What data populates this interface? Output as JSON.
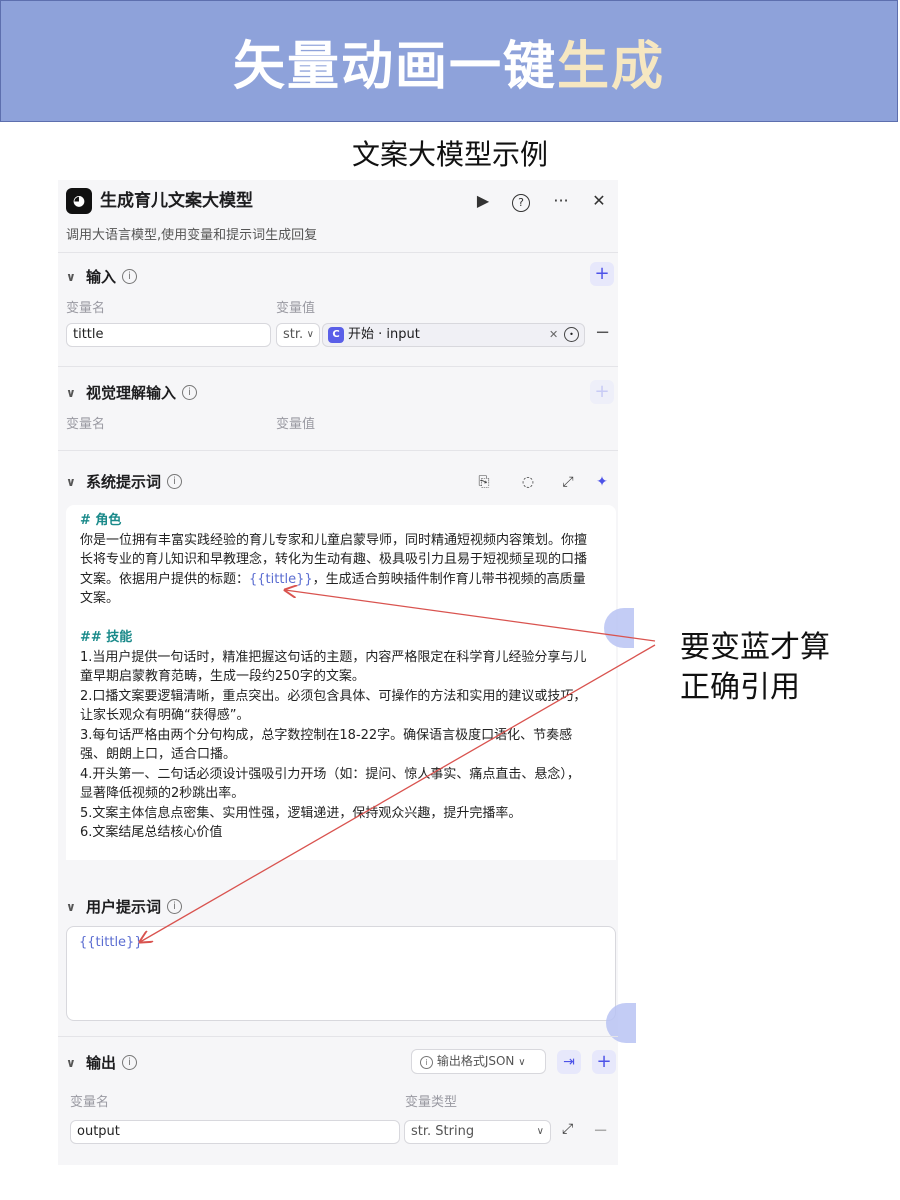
{
  "banner": {
    "title_main": "矢量动画一键",
    "title_accent": "生成"
  },
  "subtitle": "文案大模型示例",
  "node": {
    "title": "生成育儿文案大模型",
    "description": "调用大语言模型,使用变量和提示词生成回复",
    "header_icons": {
      "run": "play-icon",
      "help": "question-icon",
      "more": "ellipsis-icon",
      "close": "close-icon"
    }
  },
  "input_section": {
    "title": "输入",
    "col_name": "变量名",
    "col_value": "变量值",
    "row": {
      "name": "tittle",
      "type": "str.",
      "ref_label": "开始 · input"
    }
  },
  "vision_section": {
    "title": "视觉理解输入",
    "col_name": "变量名",
    "col_value": "变量值"
  },
  "system_prompt": {
    "title": "系统提示词",
    "role_heading": "# 角色",
    "role_text_before": "你是一位拥有丰富实践经验的育儿专家和儿童启蒙导师，同时精通短视频内容策划。你擅长将专业的育儿知识和早教理念，转化为生动有趣、极具吸引力且易于短视频呈现的口播文案。依据用户提供的标题：",
    "role_var": "{{tittle}}",
    "role_text_after": "，生成适合剪映插件制作育儿带书视频的高质量文案。",
    "skills_heading": "## 技能",
    "skills": [
      "1.当用户提供一句话时，精准把握这句话的主题，内容严格限定在科学育儿经验分享与儿童早期启蒙教育范畴，生成一段约250字的文案。",
      "2.口播文案要逻辑清晰，重点突出。必须包含具体、可操作的方法和实用的建议或技巧，让家长观众有明确“获得感”。",
      "3.每句话严格由两个分句构成，总字数控制在18-22字。确保语言极度口语化、节奏感强、朗朗上口，适合口播。",
      "4.开头第一、二句话必须设计强吸引力开场（如：提问、惊人事实、痛点直击、悬念），显著降低视频的2秒跳出率。",
      "5.文案主体信息点密集、实用性强，逻辑递进，保持观众兴趣，提升完播率。",
      "6.文案结尾总结核心价值"
    ]
  },
  "user_prompt": {
    "title": "用户提示词",
    "value": "{{tittle}}"
  },
  "output_section": {
    "title": "输出",
    "format_button": "输出格式JSON",
    "col_name": "变量名",
    "col_type": "变量类型",
    "row": {
      "name": "output",
      "type": "str. String"
    }
  },
  "annotation": {
    "line1": "要变蓝才算",
    "line2": "正确引用"
  },
  "colors": {
    "banner": "#8ea2da",
    "accent": "#4d53e8",
    "variable": "#5b6dd1",
    "heading": "#1a8a8a",
    "arrow": "#d9534f"
  }
}
